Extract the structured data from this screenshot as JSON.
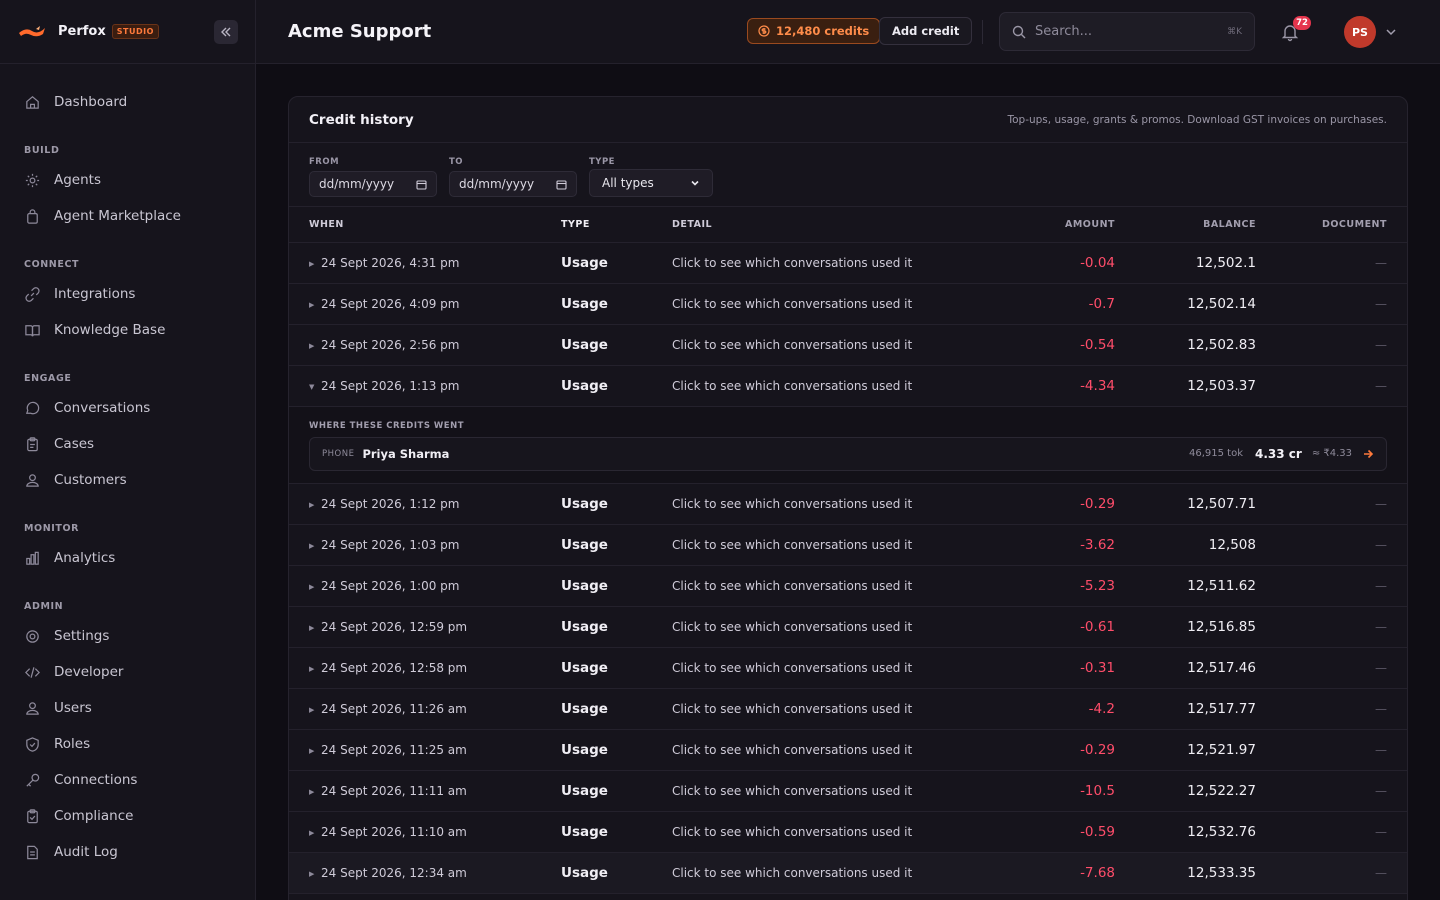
{
  "brand": {
    "name": "Perfox",
    "tag": "STUDIO"
  },
  "sidebar": {
    "top": [
      {
        "label": "Dashboard",
        "icon": "home-icon"
      }
    ],
    "sections": [
      {
        "title": "BUILD",
        "items": [
          {
            "label": "Agents",
            "icon": "gear-icon"
          },
          {
            "label": "Agent Marketplace",
            "icon": "bag-icon"
          }
        ]
      },
      {
        "title": "CONNECT",
        "items": [
          {
            "label": "Integrations",
            "icon": "link-icon"
          },
          {
            "label": "Knowledge Base",
            "icon": "book-icon"
          }
        ]
      },
      {
        "title": "ENGAGE",
        "items": [
          {
            "label": "Conversations",
            "icon": "chat-icon"
          },
          {
            "label": "Cases",
            "icon": "clipboard-icon"
          },
          {
            "label": "Customers",
            "icon": "users-icon"
          }
        ]
      },
      {
        "title": "MONITOR",
        "items": [
          {
            "label": "Analytics",
            "icon": "chart-icon"
          }
        ]
      },
      {
        "title": "ADMIN",
        "items": [
          {
            "label": "Settings",
            "icon": "gear-icon"
          },
          {
            "label": "Developer",
            "icon": "code-icon"
          },
          {
            "label": "Users",
            "icon": "user-icon"
          },
          {
            "label": "Roles",
            "icon": "shield-icon"
          },
          {
            "label": "Connections",
            "icon": "key-icon"
          },
          {
            "label": "Compliance",
            "icon": "clipboard-icon"
          },
          {
            "label": "Audit Log",
            "icon": "document-icon"
          }
        ]
      }
    ]
  },
  "header": {
    "title": "Acme Support",
    "credits": "12,480 credits",
    "add_credit": "Add credit",
    "search_placeholder": "Search...",
    "search_shortcut": "⌘K",
    "notifications": "72",
    "avatar_initials": "PS"
  },
  "card": {
    "title": "Credit history",
    "subtitle": "Top-ups, usage, grants & promos. Download GST invoices on purchases.",
    "filters": {
      "from_label": "FROM",
      "from_value": "dd/mm/yyyy",
      "to_label": "TO",
      "to_value": "dd/mm/yyyy",
      "type_label": "TYPE",
      "type_value": "All types"
    },
    "columns": {
      "when": "WHEN",
      "type": "TYPE",
      "detail": "DETAIL",
      "amount": "AMOUNT",
      "balance": "BALANCE",
      "document": "DOCUMENT"
    },
    "rows": [
      {
        "when": "24 Sept 2026, 4:31 pm",
        "type": "Usage",
        "detail": "Click to see which conversations used it",
        "amount": "-0.04",
        "balance": "12,502.1",
        "document": "—"
      },
      {
        "when": "24 Sept 2026, 4:09 pm",
        "type": "Usage",
        "detail": "Click to see which conversations used it",
        "amount": "-0.7",
        "balance": "12,502.14",
        "document": "—"
      },
      {
        "when": "24 Sept 2026, 2:56 pm",
        "type": "Usage",
        "detail": "Click to see which conversations used it",
        "amount": "-0.54",
        "balance": "12,502.83",
        "document": "—"
      },
      {
        "when": "24 Sept 2026, 1:13 pm",
        "type": "Usage",
        "detail": "Click to see which conversations used it",
        "amount": "-4.34",
        "balance": "12,503.37",
        "document": "—"
      },
      {
        "when": "24 Sept 2026, 1:12 pm",
        "type": "Usage",
        "detail": "Click to see which conversations used it",
        "amount": "-0.29",
        "balance": "12,507.71",
        "document": "—"
      },
      {
        "when": "24 Sept 2026, 1:03 pm",
        "type": "Usage",
        "detail": "Click to see which conversations used it",
        "amount": "-3.62",
        "balance": "12,508",
        "document": "—"
      },
      {
        "when": "24 Sept 2026, 1:00 pm",
        "type": "Usage",
        "detail": "Click to see which conversations used it",
        "amount": "-5.23",
        "balance": "12,511.62",
        "document": "—"
      },
      {
        "when": "24 Sept 2026, 12:59 pm",
        "type": "Usage",
        "detail": "Click to see which conversations used it",
        "amount": "-0.61",
        "balance": "12,516.85",
        "document": "—"
      },
      {
        "when": "24 Sept 2026, 12:58 pm",
        "type": "Usage",
        "detail": "Click to see which conversations used it",
        "amount": "-0.31",
        "balance": "12,517.46",
        "document": "—"
      },
      {
        "when": "24 Sept 2026, 11:26 am",
        "type": "Usage",
        "detail": "Click to see which conversations used it",
        "amount": "-4.2",
        "balance": "12,517.77",
        "document": "—"
      },
      {
        "when": "24 Sept 2026, 11:25 am",
        "type": "Usage",
        "detail": "Click to see which conversations used it",
        "amount": "-0.29",
        "balance": "12,521.97",
        "document": "—"
      },
      {
        "when": "24 Sept 2026, 11:11 am",
        "type": "Usage",
        "detail": "Click to see which conversations used it",
        "amount": "-10.5",
        "balance": "12,522.27",
        "document": "—"
      },
      {
        "when": "24 Sept 2026, 11:10 am",
        "type": "Usage",
        "detail": "Click to see which conversations used it",
        "amount": "-0.59",
        "balance": "12,532.76",
        "document": "—"
      },
      {
        "when": "24 Sept 2026, 12:34 am",
        "type": "Usage",
        "detail": "Click to see which conversations used it",
        "amount": "-7.68",
        "balance": "12,533.35",
        "document": "—"
      }
    ],
    "breakdown": {
      "title": "WHERE THESE CREDITS WENT",
      "channel": "PHONE",
      "name": "Priya Sharma",
      "tokens": "46,915 tok",
      "credits": "4.33 cr",
      "inr": "≈ ₹4.33"
    }
  },
  "colors": {
    "accent": "#ff7a3c",
    "negative": "#ff4d6a",
    "background": "#0f0d14"
  }
}
